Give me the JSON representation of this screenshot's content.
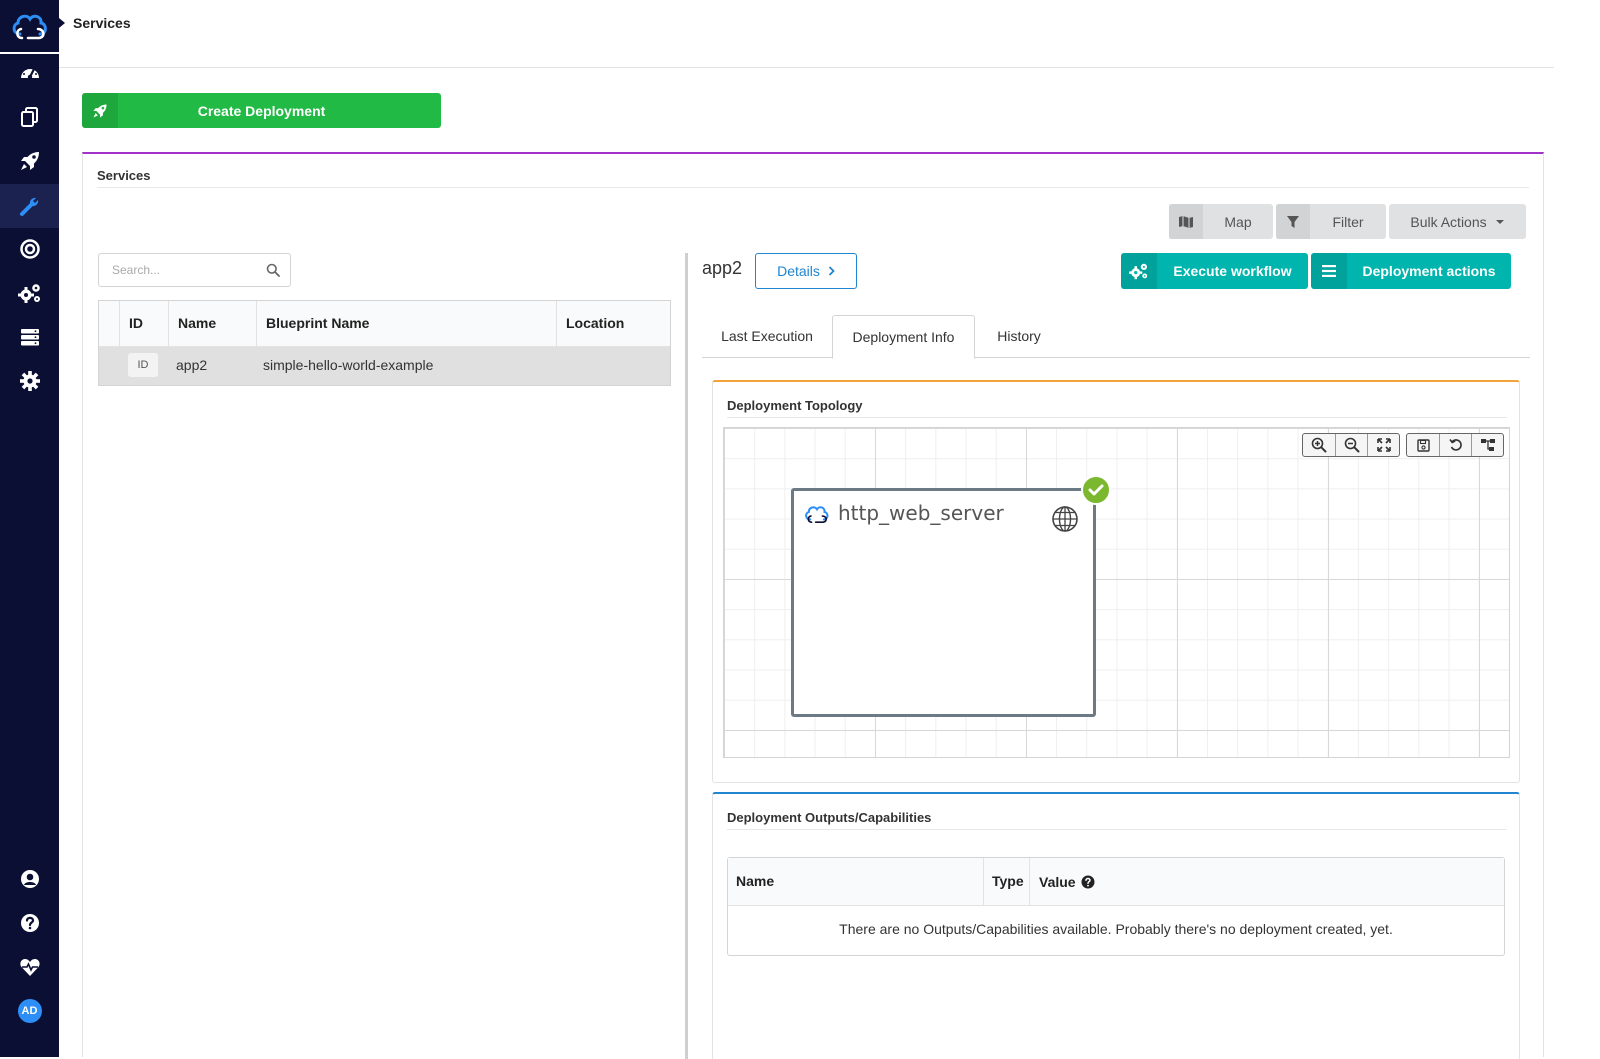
{
  "topbar": {
    "page_title": "Services"
  },
  "create_deployment": {
    "label": "Create Deployment"
  },
  "widget": {
    "title": "Services",
    "map_label": "Map",
    "filter_label": "Filter",
    "bulk_actions_label": "Bulk Actions"
  },
  "search": {
    "placeholder": "Search..."
  },
  "table": {
    "columns": [
      "ID",
      "Name",
      "Blueprint Name",
      "Location"
    ],
    "rows": [
      {
        "id": "ID",
        "name": "app2",
        "blueprint": "simple-hello-world-example",
        "location": ""
      }
    ]
  },
  "deployment": {
    "name": "app2",
    "details_label": "Details",
    "execute_workflow_label": "Execute workflow",
    "deployment_actions_label": "Deployment actions"
  },
  "tabs": [
    "Last Execution",
    "Deployment Info",
    "History"
  ],
  "active_tab": "Deployment Info",
  "topology": {
    "title": "Deployment Topology",
    "node_name": "http_web_server"
  },
  "outputs": {
    "title": "Deployment Outputs/Capabilities",
    "columns": [
      "Name",
      "Type",
      "Value"
    ],
    "empty_message": "There are no Outputs/Capabilities available. Probably there's no deployment created, yet."
  },
  "user": {
    "initials": "AD"
  },
  "colors": {
    "sidebar": "#0b0f33",
    "green": "#21ba45",
    "teal": "#00b5ad",
    "blue": "#2185d0",
    "purple": "#a333c8",
    "orange": "#f2a33a",
    "status_ok": "#7cb82f"
  },
  "icons": {
    "sidebar": [
      "dashboard-icon",
      "blueprints-icon",
      "deployments-icon",
      "services-icon",
      "executions-icon",
      "settings-cogs-icon",
      "system-resources-icon",
      "admin-gear-icon",
      "user-icon",
      "help-icon",
      "health-icon"
    ]
  }
}
